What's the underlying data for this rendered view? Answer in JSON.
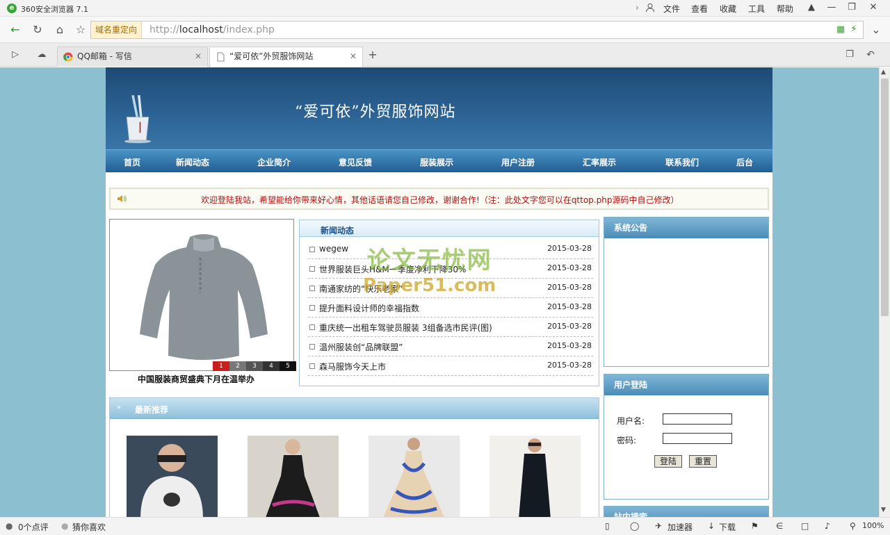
{
  "browser": {
    "title": "360安全浏览器 7.1",
    "menus": [
      "文件",
      "查看",
      "收藏",
      "工具",
      "帮助"
    ],
    "redirect_label": "域名重定向",
    "url_prefix": "http://",
    "url_host": "localhost",
    "url_path": "/index.php",
    "tabs": [
      {
        "label": "QQ邮箱 - 写信"
      },
      {
        "label": "“爱可依”外贸服饰网站"
      }
    ]
  },
  "site": {
    "title": "“爱可依”外贸服饰网站",
    "nav": [
      "首页",
      "新闻动态",
      "企业简介",
      "意见反馈",
      "服装展示",
      "用户注册",
      "汇率展示",
      "联系我们",
      "后台"
    ],
    "welcome": "欢迎登陆我站，希望能给你带来好心情，其他话语请您自己修改，谢谢合作!（注：此处文字您可以在qttop.php源码中自己修改）",
    "slide_numbers": [
      "1",
      "2",
      "3",
      "4",
      "5"
    ],
    "caption": "中国服装商贸盛典下月在温举办",
    "news": {
      "title": "新闻动态",
      "items": [
        {
          "title": "wegew",
          "date": "2015-03-28"
        },
        {
          "title": "世界服装巨头H&M一季度净利下降30%",
          "date": "2015-03-28"
        },
        {
          "title": "南通家纺的“快乐老家”",
          "date": "2015-03-28"
        },
        {
          "title": "提升面料设计师的幸福指数",
          "date": "2015-03-28"
        },
        {
          "title": "重庆统一出租车驾驶员服装 3组备选市民评(图)",
          "date": "2015-03-28"
        },
        {
          "title": "温州服装创“品牌联盟”",
          "date": "2015-03-28"
        },
        {
          "title": "森马服饰今天上市",
          "date": "2015-03-28"
        }
      ]
    },
    "recommend_title": "最新推荐",
    "notice_title": "系统公告",
    "login": {
      "title": "用户登陆",
      "username_label": "用户名:",
      "password_label": "密码:",
      "login_btn": "登陆",
      "reset_btn": "重置"
    },
    "search_title": "站内搜索",
    "watermark_line1": "论文无忧网",
    "watermark_line2": "Paper51.com"
  },
  "status": {
    "reviews": "0个点评",
    "guess": "猜你喜欢",
    "accelerator": "加速器",
    "download": "下载",
    "zoom": "100%"
  }
}
